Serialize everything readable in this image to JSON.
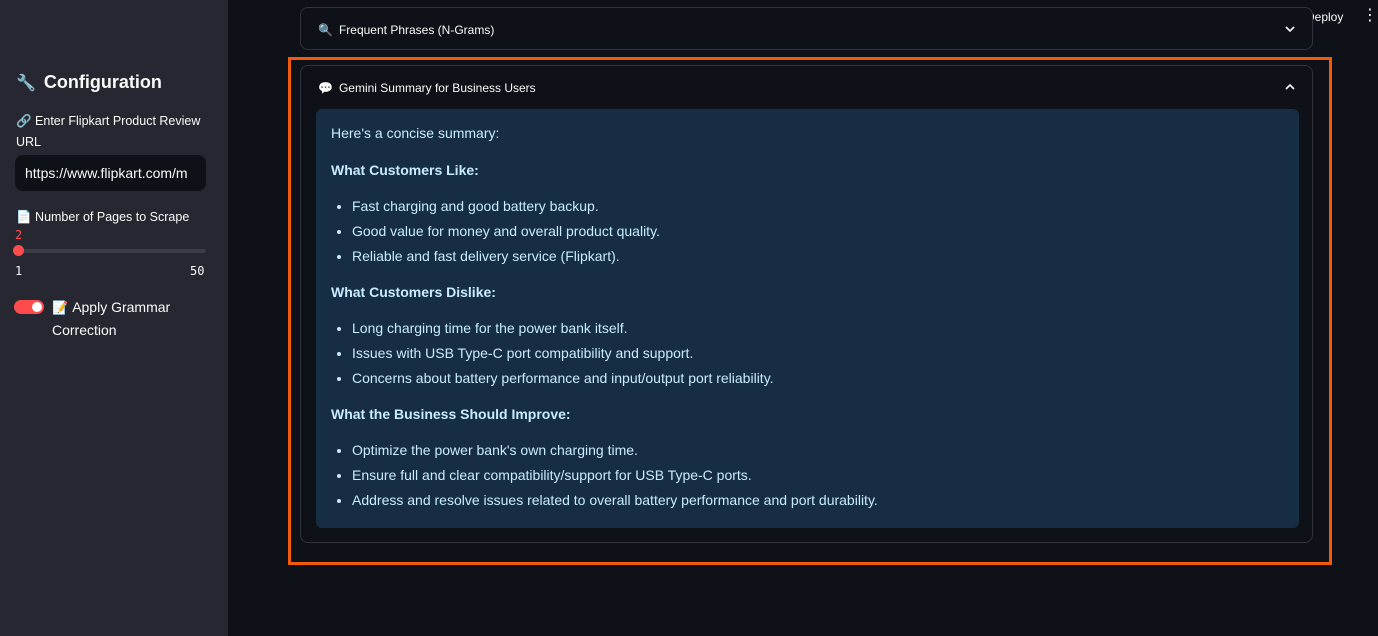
{
  "sidebar": {
    "title": "Configuration",
    "title_icon": "🔧",
    "url_label": "🔗 Enter Flipkart Product Review URL",
    "url_value": "https://www.flipkart.com/m",
    "pages_label": "📄 Number of Pages to Scrape",
    "slider_value": "2",
    "slider_min": "1",
    "slider_max": "50",
    "slider_fraction": 0.02,
    "toggle_icon": "📝",
    "toggle_label": "Apply Grammar Correction",
    "toggle_on": true
  },
  "header": {
    "deploy_label": "Deploy",
    "menu_icon": "⋮"
  },
  "expander_ngrams": {
    "icon": "🔍",
    "label": "Frequent Phrases (N-Grams)"
  },
  "expander_summary": {
    "icon": "💬",
    "label": "Gemini Summary for Business Users",
    "intro": "Here's a concise summary:",
    "likes_heading": "What Customers Like:",
    "likes": [
      "Fast charging and good battery backup.",
      "Good value for money and overall product quality.",
      "Reliable and fast delivery service (Flipkart)."
    ],
    "dislikes_heading": "What Customers Dislike:",
    "dislikes": [
      "Long charging time for the power bank itself.",
      "Issues with USB Type-C port compatibility and support.",
      "Concerns about battery performance and input/output port reliability."
    ],
    "improve_heading": "What the Business Should Improve:",
    "improve": [
      "Optimize the power bank's own charging time.",
      "Ensure full and clear compatibility/support for USB Type-C ports.",
      "Address and resolve issues related to overall battery performance and port durability."
    ]
  },
  "colors": {
    "accent": "#ff4b4b",
    "highlight_border": "#f15a0c",
    "summary_bg": "#172d43",
    "summary_text": "#c7ebff"
  }
}
